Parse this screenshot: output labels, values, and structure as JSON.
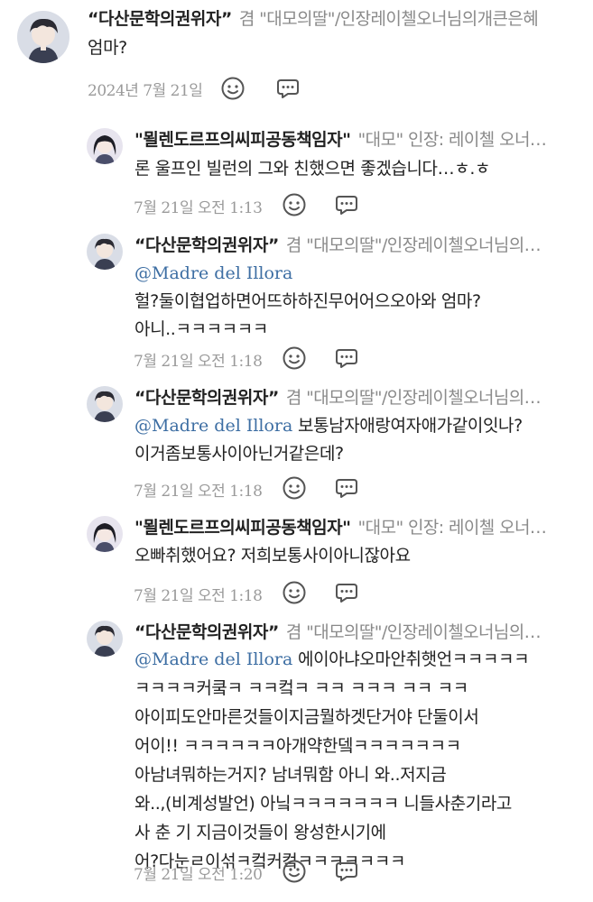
{
  "comments": [
    {
      "author": "“다산문학의권위자”",
      "subtitle": "겸 \"대모의딸\"/인장레이첼오너님의개큰은혜",
      "lines": [
        {
          "text": "엄마?"
        }
      ],
      "timestamp": "2024년 7월 21일"
    },
    {
      "author": "\"묄렌도르프의씨피공동책임자\"",
      "subtitle": "\"대모\" 인장: 레이첼 오너…",
      "lines": [
        {
          "text": "론 울프인 빌런의 그와 친했으면 좋겠습니다…ㅎ.ㅎ"
        }
      ],
      "timestamp": "7월 21일 오전 1:13"
    },
    {
      "author": "“다산문학의권위자”",
      "subtitle": "겸 \"대모의딸\"/인장레이첼오너님의…",
      "lines": [
        {
          "mention": "@Madre del Illora"
        },
        {
          "text": "헐?둘이협업하면어뜨하하진무어어으오아와 엄마?"
        },
        {
          "text": "아니..ㅋㅋㅋㅋㅋㅋ"
        }
      ],
      "timestamp": "7월 21일 오전 1:18"
    },
    {
      "author": "“다산문학의권위자”",
      "subtitle": "겸 \"대모의딸\"/인장레이첼오너님의…",
      "lines": [
        {
          "mention": "@Madre del Illora",
          "text": " 보통남자애랑여자애가같이잇나?"
        },
        {
          "text": "이거좀보통사이아닌거같은데?"
        }
      ],
      "timestamp": "7월 21일 오전 1:18"
    },
    {
      "author": "\"묄렌도르프의씨피공동책임자\"",
      "subtitle": "\"대모\" 인장: 레이첼 오너…",
      "lines": [
        {
          "text": "오빠취했어요? 저희보통사이아니잖아요"
        }
      ],
      "timestamp": "7월 21일 오전 1:18"
    },
    {
      "author": "“다산문학의권위자”",
      "subtitle": "겸 \"대모의딸\"/인장레이첼오너님의…",
      "lines": [
        {
          "mention": "@Madre del Illora",
          "text": " 에이아냐오마안취햇언ㅋㅋㅋㅋㅋ"
        },
        {
          "text": "ㅋㅋㅋㅋ커쿸ㅋ ㅋㅋ컼ㅋ ㅋㅋ ㅋㅋㅋ ㅋㅋ ㅋㅋ"
        },
        {
          "text": "아이피도안마른것들이지금뭘하겟단거야 단둘이서"
        },
        {
          "text": "어이!! ㅋㅋㅋㅋㅋㅋ아개약한뎈ㅋㅋㅋㅋㅋㅋㅋ"
        },
        {
          "text": "아남녀뭐하는거지? 남녀뭐함 아니 와..저지금"
        },
        {
          "text": "와..,(비계성발언) 아닠ㅋㅋㅋㅋㅋㅋㅋ 니들사춘기라고"
        },
        {
          "text": "사 춘 기 지금이것들이 왕성한시기에"
        },
        {
          "text": "어?다눈ㄹ이섞ㅋ컼커컼ㅋㅋㅋㅋㅋㅋㅋ"
        }
      ],
      "timestamp": "7월 21일 오전 1:20"
    }
  ],
  "icons": {
    "like": "smile-icon",
    "reply": "speech-bubble-icon"
  },
  "colors": {
    "mention": "#3d6ea3",
    "muted": "#8a8a8a",
    "text": "#222222"
  }
}
